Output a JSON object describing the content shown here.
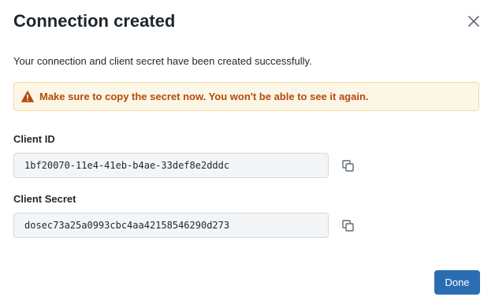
{
  "dialog": {
    "title": "Connection created",
    "description": "Your connection and client secret have been created successfully.",
    "close_icon": "close-icon"
  },
  "alert": {
    "icon": "warning-icon",
    "text": "Make sure to copy the secret now. You won't be able to see it again.",
    "color": "#b54a0e",
    "background": "#fcf6e6"
  },
  "fields": {
    "client_id": {
      "label": "Client ID",
      "value": "1bf20070-11e4-41eb-b4ae-33def8e2dddc",
      "copy_icon": "copy-icon"
    },
    "client_secret": {
      "label": "Client Secret",
      "value": "dosec73a25a0993cbc4aa42158546290d273",
      "copy_icon": "copy-icon"
    }
  },
  "footer": {
    "done_label": "Done",
    "accent": "#2b6db3"
  }
}
